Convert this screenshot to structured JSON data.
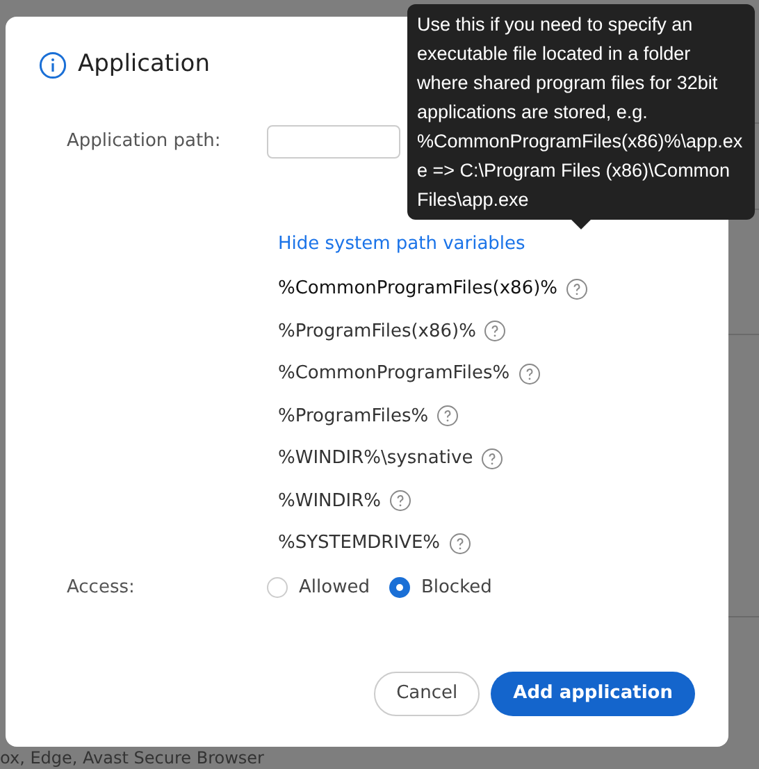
{
  "background": {
    "fragment_bottom": "ox, Edge, Avast Secure Browser"
  },
  "dialog": {
    "title": "Application",
    "path_label": "Application path:",
    "toggle_link": "Hide system path variables",
    "variables": [
      {
        "name": "%CommonProgramFiles(x86)%",
        "tooltip_open": true
      },
      {
        "name": "%ProgramFiles(x86)%",
        "tooltip_open": false
      },
      {
        "name": "%CommonProgramFiles%",
        "tooltip_open": false
      },
      {
        "name": "%ProgramFiles%",
        "tooltip_open": false
      },
      {
        "name": "%WINDIR%\\sysnative",
        "tooltip_open": false
      },
      {
        "name": "%WINDIR%",
        "tooltip_open": false
      },
      {
        "name": "%SYSTEMDRIVE%",
        "tooltip_open": false
      }
    ],
    "access_label": "Access:",
    "access_options": [
      {
        "label": "Allowed",
        "selected": false
      },
      {
        "label": "Blocked",
        "selected": true
      }
    ],
    "buttons": [
      {
        "label": "Cancel",
        "kind": "secondary"
      },
      {
        "label": "Add application",
        "kind": "primary"
      }
    ]
  },
  "tooltip": {
    "text": "Use this if you need to specify an executable file located in a folder where shared program files for 32bit applications are stored, e.g. %CommonProgramFiles(x86)%\\app.exe => C:\\Program Files (x86)\\Common Files\\app.exe"
  }
}
